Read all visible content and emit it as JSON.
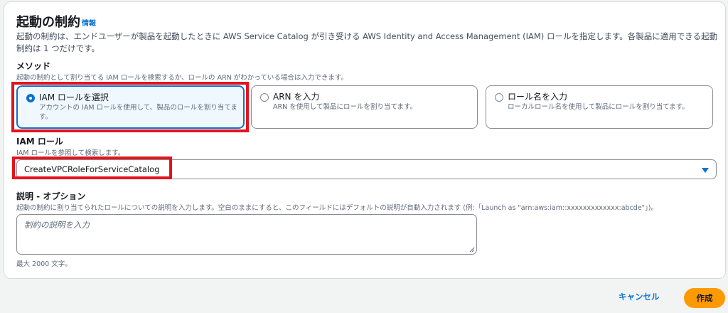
{
  "section": {
    "title": "起動の制約",
    "info_link": "情報",
    "description": "起動の制約は、エンドユーザーが製品を起動したときに AWS Service Catalog が引き受ける AWS Identity and Access Management (IAM) ロールを指定します。各製品に適用できる起動制約は 1 つだけです。"
  },
  "method": {
    "label": "メソッド",
    "hint": "起動の制約として割り当てる IAM ロールを検索するか、ロールの ARN がわかっている場合は入力できます。",
    "options": [
      {
        "label": "IAM ロールを選択",
        "description": "アカウントの IAM ロールを使用して、製品のロールを割り当てます。",
        "selected": true
      },
      {
        "label": "ARN を入力",
        "description": "ARN を使用して製品にロールを割り当てます。",
        "selected": false
      },
      {
        "label": "ロール名を入力",
        "description": "ローカルロール名を使用して製品にロールを割り当てます。",
        "selected": false
      }
    ]
  },
  "iam_role": {
    "label": "IAM ロール",
    "hint": "IAM ロールを参照して検索します。",
    "selected_value": "CreateVPCRoleForServiceCatalog"
  },
  "description_field": {
    "label": "説明 - オプション",
    "hint": "起動の制約に割り当てられたロールについての説明を入力します。空白のままにすると、このフィールドにはデフォルトの説明が自動入力されます (例:「Launch as \"arn:aws:iam::xxxxxxxxxxxxx:abcde\"」)。",
    "placeholder": "制約の説明を入力",
    "constraint": "最大 2000 文字。"
  },
  "footer": {
    "cancel_label": "キャンセル",
    "create_label": "作成"
  },
  "colors": {
    "accent": "#0972d3",
    "primary_button": "#ff9900",
    "highlight_annotation": "#e5141c"
  }
}
